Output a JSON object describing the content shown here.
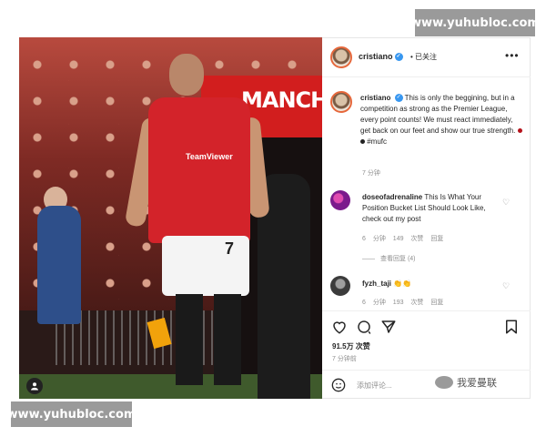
{
  "watermark_top": "www.yuhubloc.com",
  "watermark_bottom": "www.yuhubloc.com",
  "photo": {
    "banner_text": "MANCH",
    "shirt_sponsor": "TeamViewer",
    "shorts_number": "7"
  },
  "header": {
    "username": "cristiano",
    "verified_icon": "verified-badge-icon",
    "separator": "•",
    "follow_status": "已关注",
    "more_icon": "more-options-icon"
  },
  "caption": {
    "username": "cristiano",
    "text": "This is only the beggining, but in a competition as strong as the Premier League, every point counts! We must react immediately, get back on our feet and show our true strength.",
    "hashtag": "#mufc",
    "time": "7 分钟"
  },
  "comments": [
    {
      "username": "doseofadrenaline",
      "text": "This Is What Your Position Bucket List Should Look Like, check out my post",
      "time": "6 分钟",
      "likes": "149 次赞",
      "reply": "回复",
      "view_replies": "查看回复 (4)"
    },
    {
      "username": "fyzh_taji",
      "text": "👏👏",
      "time": "6 分钟",
      "likes": "193 次赞",
      "reply": "回复"
    }
  ],
  "post_stats": {
    "likes": "91.5万 次赞",
    "time": "7 分钟前"
  },
  "comment_box": {
    "placeholder": "添加评论..."
  },
  "wechat_watermark": "我爱曼联",
  "colors": {
    "verified": "#3897f0",
    "muted_text": "#8e8e8e"
  }
}
